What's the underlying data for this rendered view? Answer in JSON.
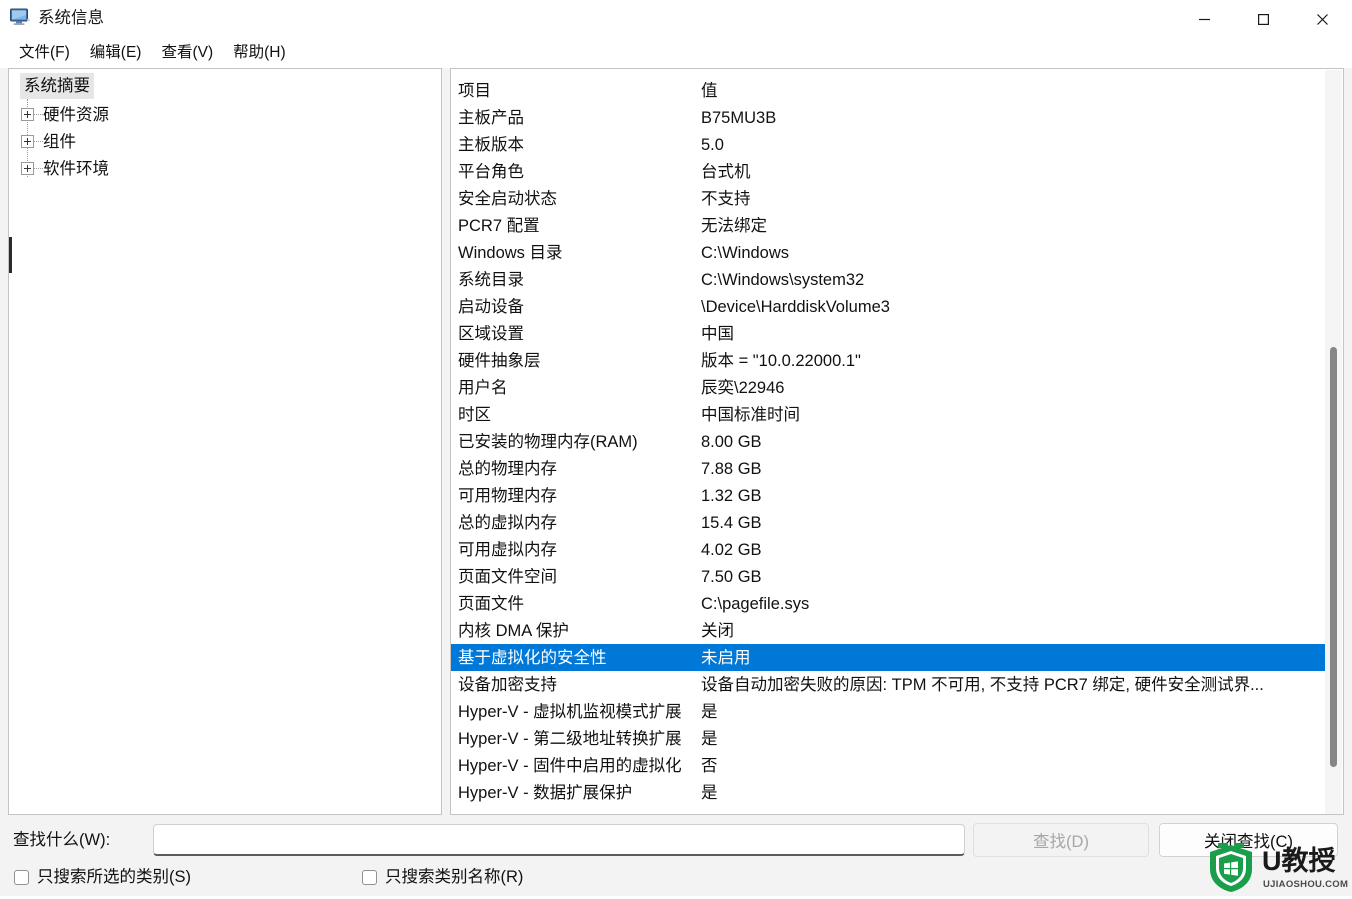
{
  "window": {
    "title": "系统信息",
    "app_icon": "computer-monitor-icon",
    "minimize_label": "最小化",
    "maximize_label": "最大化",
    "close_label": "关闭"
  },
  "menubar": {
    "items": [
      {
        "label": "文件(F)"
      },
      {
        "label": "编辑(E)"
      },
      {
        "label": "查看(V)"
      },
      {
        "label": "帮助(H)"
      }
    ]
  },
  "tree": {
    "root": {
      "label": "系统摘要",
      "selected": true
    },
    "children": [
      {
        "label": "硬件资源",
        "expander": "plus-icon"
      },
      {
        "label": "组件",
        "expander": "plus-icon"
      },
      {
        "label": "软件环境",
        "expander": "plus-icon"
      }
    ]
  },
  "list": {
    "columns": {
      "item": "项目",
      "value": "值"
    },
    "rows": [
      {
        "item": "主板产品",
        "value": "B75MU3B"
      },
      {
        "item": "主板版本",
        "value": "5.0"
      },
      {
        "item": "平台角色",
        "value": "台式机"
      },
      {
        "item": "安全启动状态",
        "value": "不支持"
      },
      {
        "item": "PCR7 配置",
        "value": "无法绑定"
      },
      {
        "item": "Windows 目录",
        "value": "C:\\Windows"
      },
      {
        "item": "系统目录",
        "value": "C:\\Windows\\system32"
      },
      {
        "item": "启动设备",
        "value": "\\Device\\HarddiskVolume3"
      },
      {
        "item": "区域设置",
        "value": "中国"
      },
      {
        "item": "硬件抽象层",
        "value": "版本 = \"10.0.22000.1\""
      },
      {
        "item": "用户名",
        "value": "辰奕\\22946"
      },
      {
        "item": "时区",
        "value": "中国标准时间"
      },
      {
        "item": "已安装的物理内存(RAM)",
        "value": "8.00 GB"
      },
      {
        "item": "总的物理内存",
        "value": "7.88 GB"
      },
      {
        "item": "可用物理内存",
        "value": "1.32 GB"
      },
      {
        "item": "总的虚拟内存",
        "value": "15.4 GB"
      },
      {
        "item": "可用虚拟内存",
        "value": "4.02 GB"
      },
      {
        "item": "页面文件空间",
        "value": "7.50 GB"
      },
      {
        "item": "页面文件",
        "value": "C:\\pagefile.sys"
      },
      {
        "item": "内核 DMA 保护",
        "value": "关闭"
      },
      {
        "item": "基于虚拟化的安全性",
        "value": "未启用",
        "selected": true
      },
      {
        "item": "设备加密支持",
        "value": "设备自动加密失败的原因: TPM 不可用, 不支持 PCR7 绑定, 硬件安全测试界..."
      },
      {
        "item": "Hyper-V - 虚拟机监视模式扩展",
        "value": "是"
      },
      {
        "item": "Hyper-V - 第二级地址转换扩展",
        "value": "是"
      },
      {
        "item": "Hyper-V - 固件中启用的虚拟化",
        "value": "否"
      },
      {
        "item": "Hyper-V - 数据扩展保护",
        "value": "是"
      }
    ],
    "selection_color": "#0078d7"
  },
  "findbar": {
    "label": "查找什么(W):",
    "input_value": "",
    "input_placeholder": "",
    "find_button": "查找(D)",
    "find_button_disabled": true,
    "close_find_button": "关闭查找(C)",
    "checkbox_selected_category": "只搜索所选的类别(S)",
    "checkbox_category_name": "只搜索类别名称(R)"
  },
  "watermark": {
    "brand": "U教授",
    "domain": "UJIAOSHOU.COM",
    "color": "#1a9e4b"
  }
}
